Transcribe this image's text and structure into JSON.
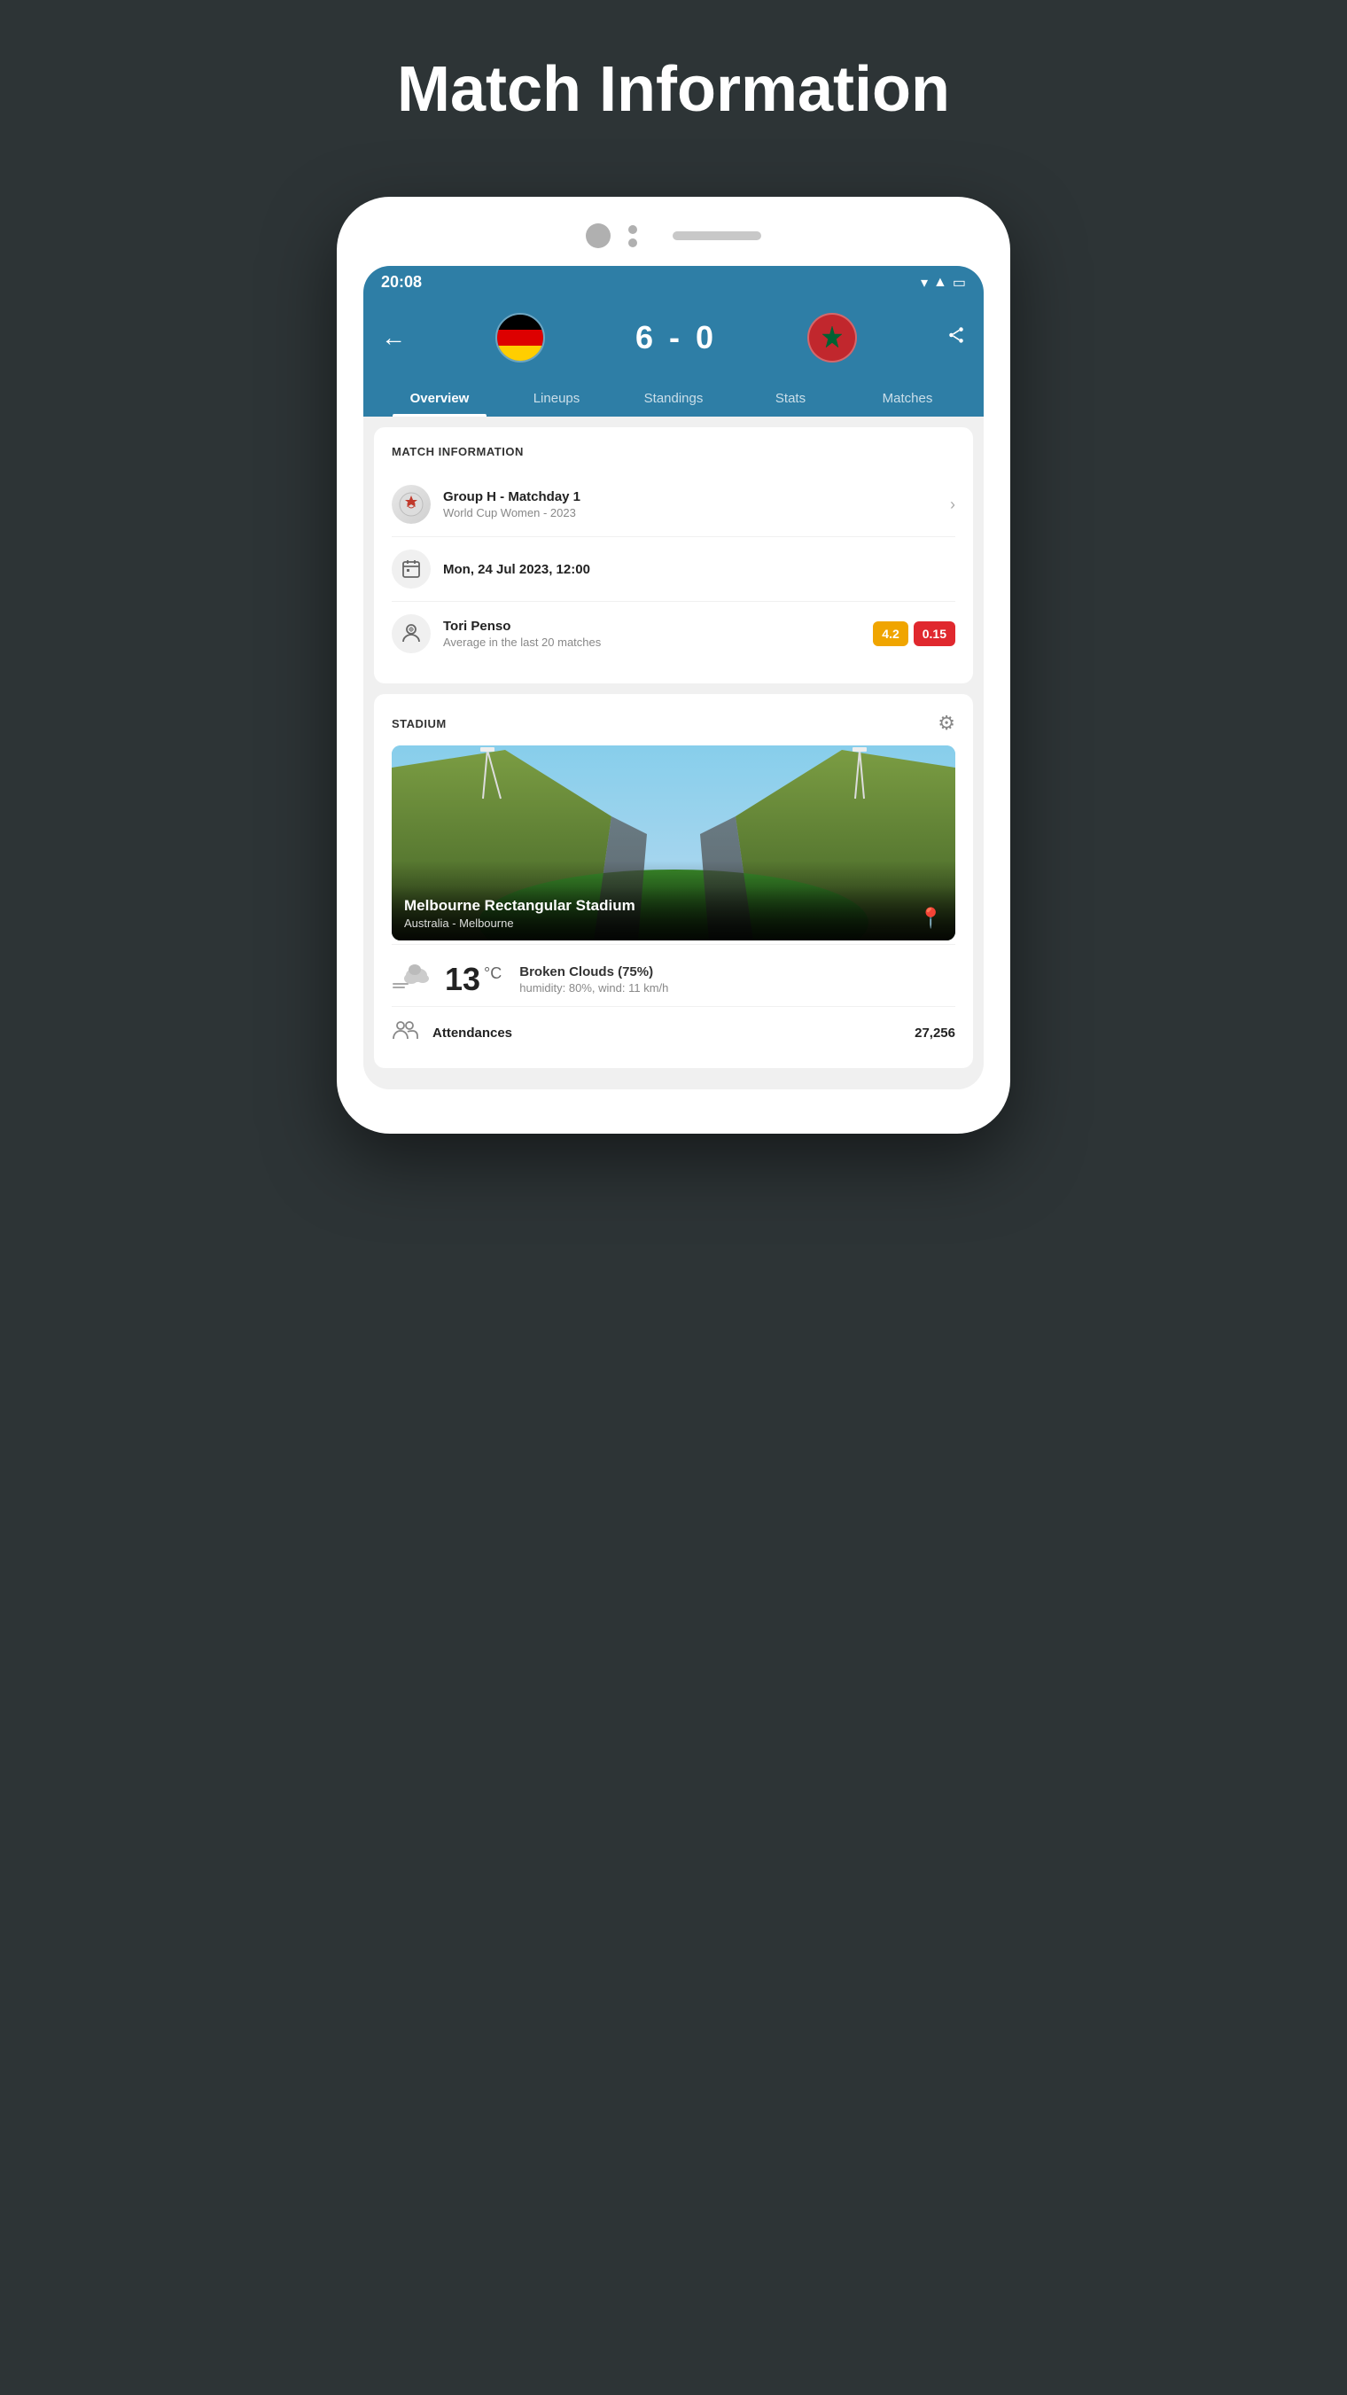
{
  "page": {
    "title": "Match Information"
  },
  "status_bar": {
    "time": "20:08"
  },
  "header": {
    "score": "6 - 0",
    "back_label": "←",
    "share_label": "⋮"
  },
  "tabs": [
    {
      "id": "overview",
      "label": "Overview",
      "active": true
    },
    {
      "id": "lineups",
      "label": "Lineups",
      "active": false
    },
    {
      "id": "standings",
      "label": "Standings",
      "active": false
    },
    {
      "id": "stats",
      "label": "Stats",
      "active": false
    },
    {
      "id": "matches",
      "label": "Matches",
      "active": false
    }
  ],
  "match_info": {
    "section_title": "MATCH INFORMATION",
    "competition": {
      "name": "Group H - Matchday 1",
      "sub": "World Cup Women - 2023"
    },
    "datetime": {
      "label": "Mon, 24 Jul 2023, 12:00"
    },
    "referee": {
      "name": "Tori Penso",
      "sub": "Average in the last 20 matches",
      "badge_yellow": "4.2",
      "badge_red": "0.15"
    }
  },
  "stadium": {
    "section_title": "STADIUM",
    "name": "Melbourne Rectangular Stadium",
    "location": "Australia - Melbourne"
  },
  "weather": {
    "temperature": "13",
    "unit": "°C",
    "description": "Broken Clouds (75%)",
    "details": "humidity: 80%, wind: 11 km/h"
  },
  "attendance": {
    "label": "Attendances",
    "value": "27,256"
  }
}
